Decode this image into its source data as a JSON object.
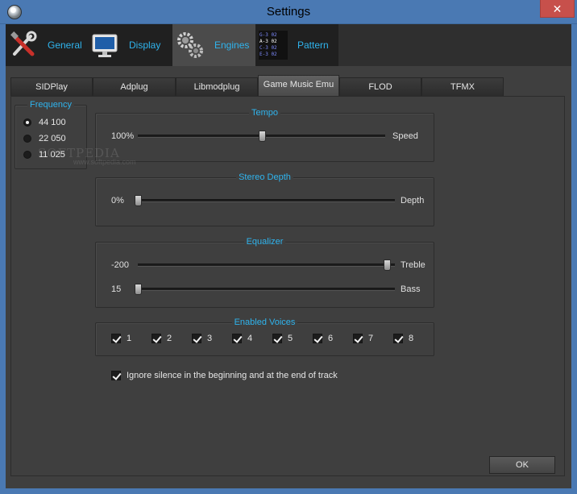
{
  "window": {
    "title": "Settings",
    "close_glyph": "✕"
  },
  "main_tabs": [
    {
      "label": "General",
      "icon": "tools-icon"
    },
    {
      "label": "Display",
      "icon": "monitor-icon"
    },
    {
      "label": "Engines",
      "icon": "gears-icon",
      "active": true
    },
    {
      "label": "Pattern",
      "icon": "pattern-icon"
    }
  ],
  "pattern_icon_text": [
    "G-3 02",
    "A-3 02",
    "C-3 02",
    "E-3 02"
  ],
  "sub_tabs": [
    {
      "label": "SIDPlay"
    },
    {
      "label": "Adplug"
    },
    {
      "label": "Libmodplug"
    },
    {
      "label": "Game Music Emu",
      "active": true
    },
    {
      "label": "FLOD"
    },
    {
      "label": "TFMX"
    }
  ],
  "frequency": {
    "title": "Frequency",
    "options": [
      "44 100",
      "22 050",
      "11 025"
    ],
    "selected": "44 100"
  },
  "tempo": {
    "title": "Tempo",
    "left_label": "100%",
    "right_label": "Speed",
    "position": 0.5
  },
  "stereo_depth": {
    "title": "Stereo Depth",
    "left_label": "0%",
    "right_label": "Depth",
    "position": 0.0
  },
  "equalizer": {
    "title": "Equalizer",
    "treble": {
      "left_label": "-200",
      "right_label": "Treble",
      "position": 1.0
    },
    "bass": {
      "left_label": "15",
      "right_label": "Bass",
      "position": 0.0
    }
  },
  "enabled_voices": {
    "title": "Enabled Voices",
    "voices": [
      {
        "label": "1",
        "checked": true
      },
      {
        "label": "2",
        "checked": true
      },
      {
        "label": "3",
        "checked": true
      },
      {
        "label": "4",
        "checked": true
      },
      {
        "label": "5",
        "checked": true
      },
      {
        "label": "6",
        "checked": true
      },
      {
        "label": "7",
        "checked": true
      },
      {
        "label": "8",
        "checked": true
      }
    ]
  },
  "ignore_silence": {
    "label": "Ignore silence in the beginning and at the end of track",
    "checked": true
  },
  "ok_label": "OK",
  "watermark": {
    "brand": "SOFTPEDIA",
    "url": "www.softpedia.com"
  },
  "colors": {
    "accent": "#2fb4ee",
    "titlebar": "#4a79b3",
    "close": "#c7504b"
  }
}
